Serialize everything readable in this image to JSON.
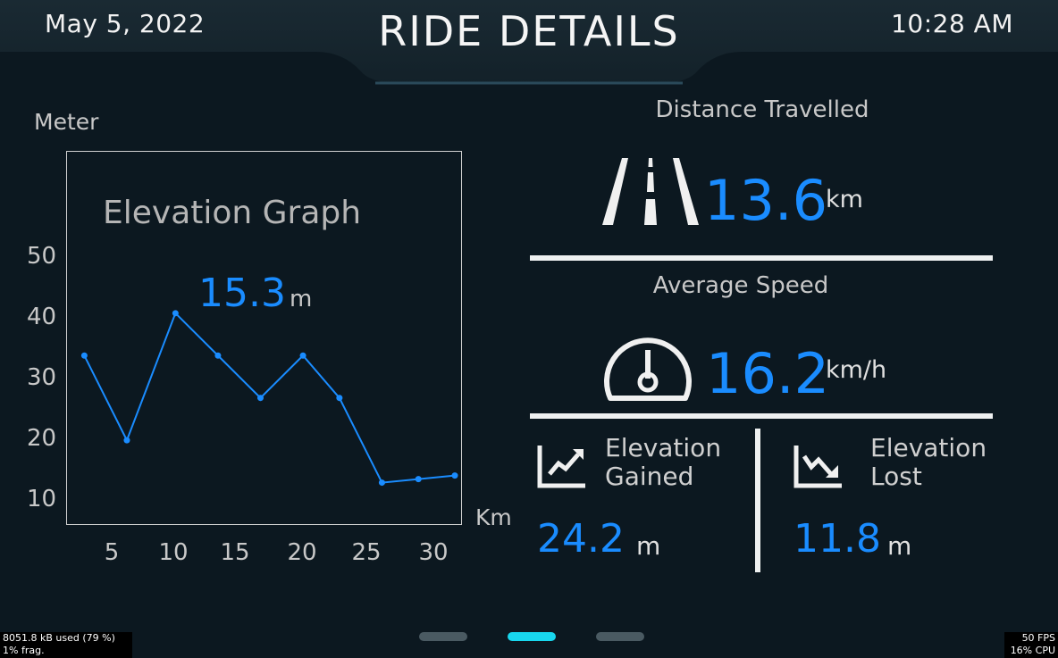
{
  "header": {
    "date": "May 5, 2022",
    "title": "RIDE DETAILS",
    "time": "10:28 AM"
  },
  "elevation_graph": {
    "title": "Elevation Graph",
    "current_value": "15.3",
    "current_unit": "m",
    "y_axis_label": "Meter",
    "x_axis_unit": "Km"
  },
  "chart_data": {
    "type": "line",
    "title": "Elevation Graph",
    "xlabel": "Km",
    "ylabel": "Meter",
    "x_ticks": [
      "5",
      "10",
      "15",
      "20",
      "25",
      "30"
    ],
    "y_ticks": [
      "50",
      "40",
      "30",
      "20",
      "10"
    ],
    "xlim": [
      0,
      32
    ],
    "ylim": [
      7,
      60
    ],
    "series": [
      {
        "color": "#1a8cff",
        "x": [
          1.5,
          5,
          9,
          12.5,
          16,
          19.5,
          22.5,
          26,
          29,
          32
        ],
        "y": [
          31,
          19,
          37,
          31,
          25,
          31,
          25,
          13,
          13.5,
          14
        ]
      }
    ],
    "grid": false,
    "legend": "none"
  },
  "distance": {
    "label": "Distance Travelled",
    "value": "13.6",
    "unit": "km",
    "icon": "road-icon"
  },
  "speed": {
    "label": "Average Speed",
    "value": "16.2",
    "unit": "km/h",
    "icon": "speedometer-icon"
  },
  "elevation_gained": {
    "label_line1": "Elevation",
    "label_line2": "Gained",
    "value": "24.2",
    "unit": "m",
    "icon": "trend-up-icon"
  },
  "elevation_lost": {
    "label_line1": "Elevation",
    "label_line2": "Lost",
    "value": "11.8",
    "unit": "m",
    "icon": "trend-down-icon"
  },
  "pager": {
    "count": 3,
    "active_index": 1
  },
  "debug": {
    "memory": "8051.8 kB used (79 %)",
    "frag": "1% frag.",
    "fps": "50 FPS",
    "cpu": "16% CPU"
  },
  "colors": {
    "accent": "#1a8cff",
    "background": "#0c1820",
    "pager_active": "#18d7ee"
  }
}
